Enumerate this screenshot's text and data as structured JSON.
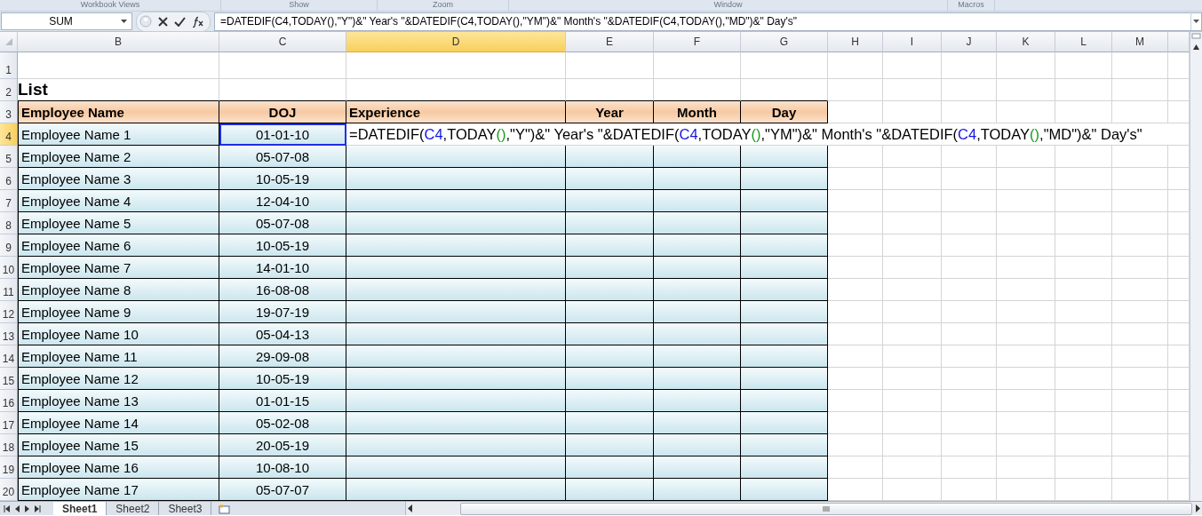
{
  "ribbon_groups": [
    "Workbook Views",
    "Show",
    "Zoom",
    "Window",
    "Macros"
  ],
  "formula_bar": {
    "name_box": "SUM",
    "formula": "=DATEDIF(C4,TODAY(),\"Y\")&\" Year's \"&DATEDIF(C4,TODAY(),\"YM\")&\" Month's \"&DATEDIF(C4,TODAY(),\"MD\")&\" Day's\""
  },
  "column_headers": [
    {
      "label": "B",
      "selected": false
    },
    {
      "label": "C",
      "selected": false
    },
    {
      "label": "D",
      "selected": true
    },
    {
      "label": "E",
      "selected": false
    },
    {
      "label": "F",
      "selected": false
    },
    {
      "label": "G",
      "selected": false
    },
    {
      "label": "H",
      "selected": false
    },
    {
      "label": "I",
      "selected": false
    },
    {
      "label": "J",
      "selected": false
    },
    {
      "label": "K",
      "selected": false
    },
    {
      "label": "L",
      "selected": false
    },
    {
      "label": "M",
      "selected": false
    }
  ],
  "row_headers": [
    {
      "label": "1",
      "selected": false
    },
    {
      "label": "2",
      "selected": false
    },
    {
      "label": "3",
      "selected": false
    },
    {
      "label": "4",
      "selected": true
    },
    {
      "label": "5",
      "selected": false
    },
    {
      "label": "6",
      "selected": false
    },
    {
      "label": "7",
      "selected": false
    },
    {
      "label": "8",
      "selected": false
    },
    {
      "label": "9",
      "selected": false
    },
    {
      "label": "10",
      "selected": false
    },
    {
      "label": "11",
      "selected": false
    },
    {
      "label": "12",
      "selected": false
    },
    {
      "label": "13",
      "selected": false
    },
    {
      "label": "14",
      "selected": false
    },
    {
      "label": "15",
      "selected": false
    },
    {
      "label": "16",
      "selected": false
    },
    {
      "label": "17",
      "selected": false
    },
    {
      "label": "18",
      "selected": false
    },
    {
      "label": "19",
      "selected": false
    },
    {
      "label": "20",
      "selected": false
    }
  ],
  "title": "List",
  "table": {
    "columns": [
      "Employee Name",
      "DOJ",
      "Experience",
      "Year",
      "Month",
      "Day"
    ],
    "rows": [
      {
        "name": "Employee Name 1",
        "doj": {
          "text": "01-01-10",
          "selected": true
        },
        "experience": [
          {
            "kind": "plain",
            "text": "=DATEDIF("
          },
          {
            "kind": "ref",
            "text": "C4"
          },
          {
            "kind": "plain",
            "text": ",TODAY"
          },
          {
            "kind": "paren",
            "text": "()"
          },
          {
            "kind": "plain",
            "text": ",\"Y\")&\" Year's \"&DATEDIF("
          },
          {
            "kind": "ref",
            "text": "C4"
          },
          {
            "kind": "plain",
            "text": ",TODAY"
          },
          {
            "kind": "paren",
            "text": "()"
          },
          {
            "kind": "plain",
            "text": ",\"YM\")&\" Month's \"&DATEDIF("
          },
          {
            "kind": "ref",
            "text": "C4"
          },
          {
            "kind": "plain",
            "text": ",TODAY"
          },
          {
            "kind": "paren",
            "text": "()"
          },
          {
            "kind": "plain",
            "text": ",\"MD\")&\" Day's\""
          }
        ]
      },
      {
        "name": "Employee Name 2",
        "doj": {
          "text": "05-07-08",
          "selected": false
        }
      },
      {
        "name": "Employee Name 3",
        "doj": {
          "text": "10-05-19",
          "selected": false
        }
      },
      {
        "name": "Employee Name 4",
        "doj": {
          "text": "12-04-10",
          "selected": false
        }
      },
      {
        "name": "Employee Name 5",
        "doj": {
          "text": "05-07-08",
          "selected": false
        }
      },
      {
        "name": "Employee Name 6",
        "doj": {
          "text": "10-05-19",
          "selected": false
        }
      },
      {
        "name": "Employee Name 7",
        "doj": {
          "text": "14-01-10",
          "selected": false
        }
      },
      {
        "name": "Employee Name 8",
        "doj": {
          "text": "16-08-08",
          "selected": false
        }
      },
      {
        "name": "Employee Name 9",
        "doj": {
          "text": "19-07-19",
          "selected": false
        }
      },
      {
        "name": "Employee Name 10",
        "doj": {
          "text": "05-04-13",
          "selected": false
        }
      },
      {
        "name": "Employee Name 11",
        "doj": {
          "text": "29-09-08",
          "selected": false
        }
      },
      {
        "name": "Employee Name 12",
        "doj": {
          "text": "10-05-19",
          "selected": false
        }
      },
      {
        "name": "Employee Name 13",
        "doj": {
          "text": "01-01-15",
          "selected": false
        }
      },
      {
        "name": "Employee Name 14",
        "doj": {
          "text": "05-02-08",
          "selected": false
        }
      },
      {
        "name": "Employee Name 15",
        "doj": {
          "text": "20-05-19",
          "selected": false
        }
      },
      {
        "name": "Employee Name 16",
        "doj": {
          "text": "10-08-10",
          "selected": false
        }
      },
      {
        "name": "Employee Name 17",
        "doj": {
          "text": "05-07-07",
          "selected": false
        }
      }
    ]
  },
  "sheet_tabs": [
    {
      "label": "Sheet1",
      "selected": true
    },
    {
      "label": "Sheet2",
      "selected": false
    },
    {
      "label": "Sheet3",
      "selected": false
    }
  ]
}
